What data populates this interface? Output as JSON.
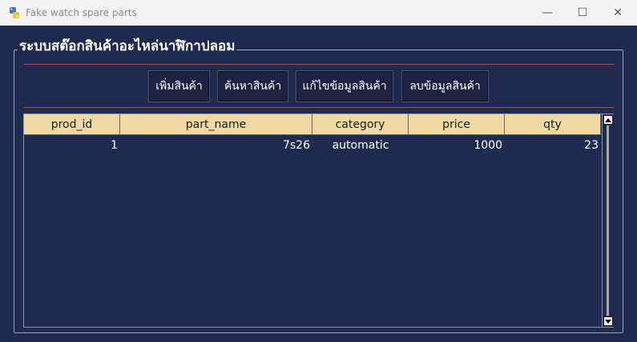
{
  "window": {
    "title": "Fake watch spare parts",
    "controls": {
      "minimize": "—",
      "maximize": "☐",
      "close": "✕"
    }
  },
  "group": {
    "title": "ระบบสต๊อกสินค้าอะไหล่นาฬิกาปลอม"
  },
  "toolbar": {
    "add_label": "เพิ่มสินค้า",
    "search_label": "ค้นหาสินค้า",
    "edit_label": "แก้ไขข้อมูลสินค้า",
    "delete_label": "ลบข้อมูลสินค้า"
  },
  "table": {
    "columns": [
      "prod_id",
      "part_name",
      "category",
      "price",
      "qty"
    ],
    "rows": [
      [
        "1",
        "7s26",
        "automatic",
        "1000",
        "23"
      ]
    ]
  },
  "colors": {
    "background": "#1f2a4f",
    "header": "#f0d9a0",
    "accent_line": "#d63a3a"
  },
  "icons": {
    "app": "python-icon"
  }
}
